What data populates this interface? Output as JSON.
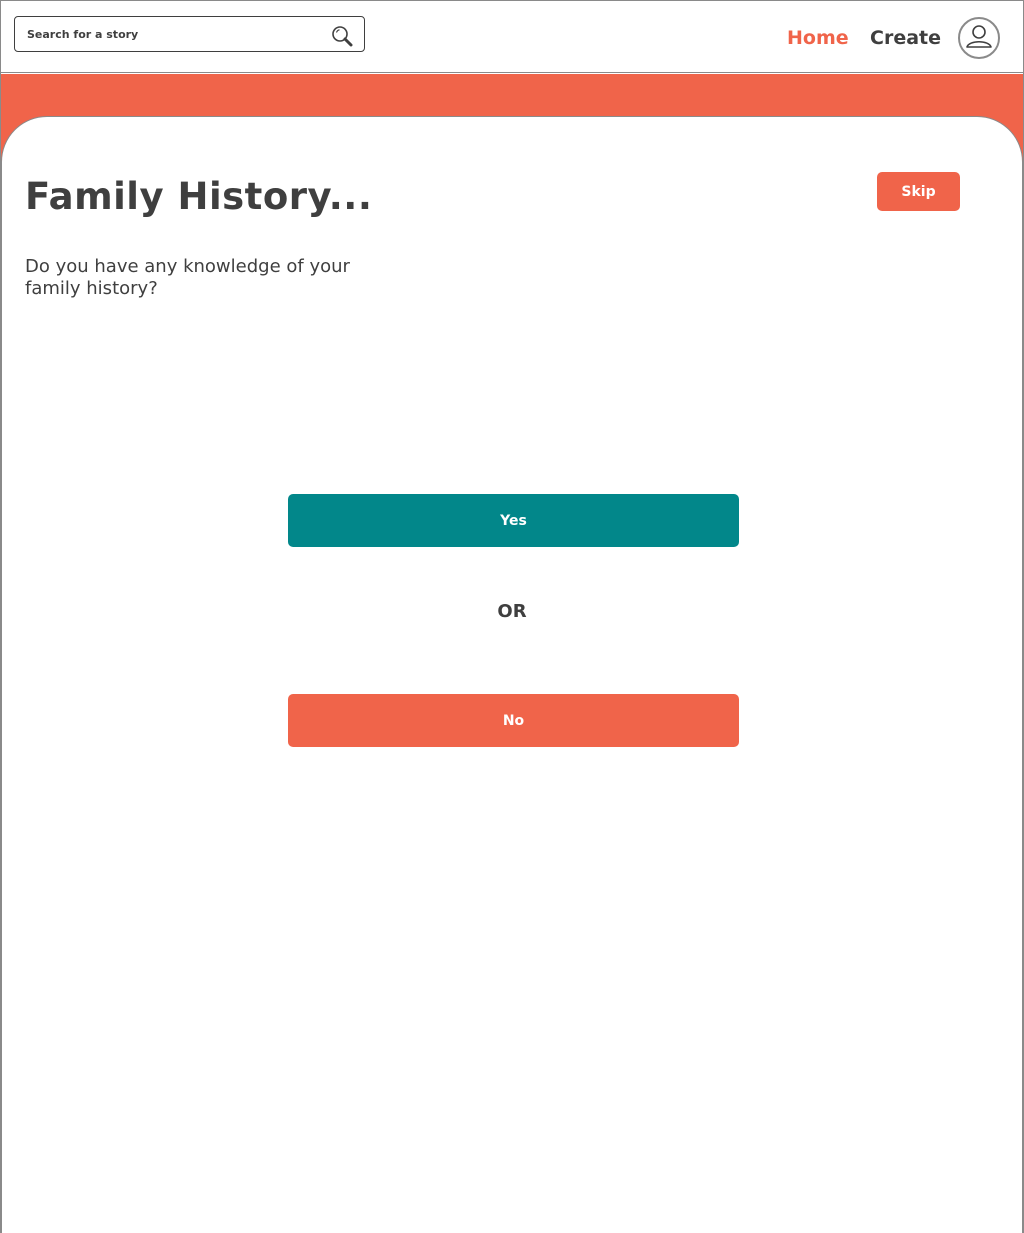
{
  "header": {
    "search": {
      "placeholder": "Search for a story",
      "value": ""
    },
    "icons": {
      "search": "search-icon",
      "avatar": "user-avatar-icon"
    },
    "nav": {
      "home_label": "Home",
      "create_label": "Create"
    }
  },
  "main": {
    "title": "Family History...",
    "question": "Do you have any knowledge of your family history?",
    "skip_label": "Skip",
    "yes_label": "Yes",
    "or_label": "OR",
    "no_label": "No"
  },
  "colors": {
    "accent": "#f0644a",
    "teal": "#02878a",
    "text": "#3f3f3f",
    "border": "#8a8a8a"
  }
}
